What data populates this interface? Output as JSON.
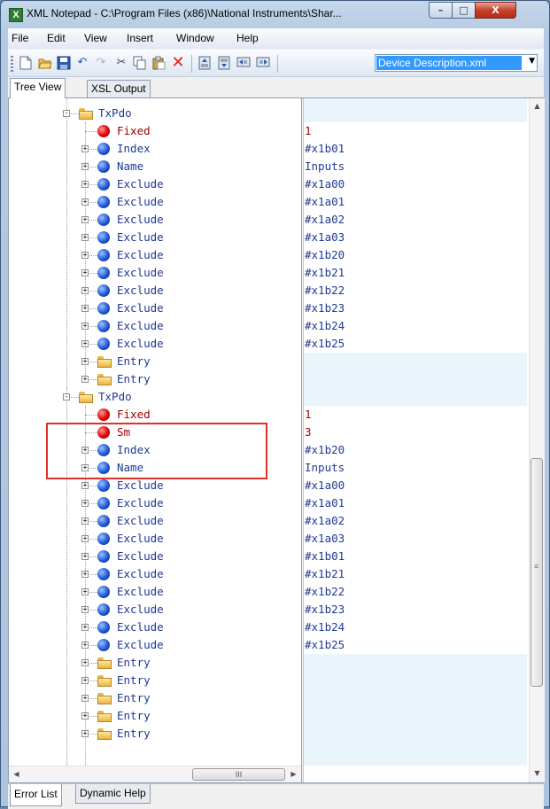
{
  "window": {
    "title": "XML Notepad - C:\\Program Files (x86)\\National Instruments\\Shar...",
    "app_icon": "X",
    "controls": {
      "minimize": "–",
      "maximize": "□",
      "close": "X"
    }
  },
  "menu": [
    "File",
    "Edit",
    "View",
    "Insert",
    "Window",
    "Help"
  ],
  "toolbar": {
    "icons": [
      "new-icon",
      "open-icon",
      "save-icon",
      "undo-icon",
      "redo-icon",
      "cut-icon",
      "copy-icon",
      "paste-icon",
      "delete-icon",
      "nudge-up-icon",
      "nudge-down-icon",
      "nudge-left-icon",
      "nudge-right-icon"
    ],
    "file_combo": "Device Description.xml"
  },
  "tabs_top": [
    "Tree View",
    "XSL Output"
  ],
  "tabs_bottom": [
    "Error List",
    "Dynamic Help"
  ],
  "tree": [
    {
      "level": 0,
      "kind": "folder",
      "expander": "-",
      "label": "TxPdo",
      "value": ""
    },
    {
      "level": 1,
      "kind": "attr",
      "expander": "",
      "label": "Fixed",
      "value": "1"
    },
    {
      "level": 1,
      "kind": "elem",
      "expander": "+",
      "label": "Index",
      "value": "#x1b01"
    },
    {
      "level": 1,
      "kind": "elem",
      "expander": "+",
      "label": "Name",
      "value": "Inputs"
    },
    {
      "level": 1,
      "kind": "elem",
      "expander": "+",
      "label": "Exclude",
      "value": "#x1a00"
    },
    {
      "level": 1,
      "kind": "elem",
      "expander": "+",
      "label": "Exclude",
      "value": "#x1a01"
    },
    {
      "level": 1,
      "kind": "elem",
      "expander": "+",
      "label": "Exclude",
      "value": "#x1a02"
    },
    {
      "level": 1,
      "kind": "elem",
      "expander": "+",
      "label": "Exclude",
      "value": "#x1a03"
    },
    {
      "level": 1,
      "kind": "elem",
      "expander": "+",
      "label": "Exclude",
      "value": "#x1b20"
    },
    {
      "level": 1,
      "kind": "elem",
      "expander": "+",
      "label": "Exclude",
      "value": "#x1b21"
    },
    {
      "level": 1,
      "kind": "elem",
      "expander": "+",
      "label": "Exclude",
      "value": "#x1b22"
    },
    {
      "level": 1,
      "kind": "elem",
      "expander": "+",
      "label": "Exclude",
      "value": "#x1b23"
    },
    {
      "level": 1,
      "kind": "elem",
      "expander": "+",
      "label": "Exclude",
      "value": "#x1b24"
    },
    {
      "level": 1,
      "kind": "elem",
      "expander": "+",
      "label": "Exclude",
      "value": "#x1b25"
    },
    {
      "level": 1,
      "kind": "folder",
      "expander": "+",
      "label": "Entry",
      "value": ""
    },
    {
      "level": 1,
      "kind": "folder",
      "expander": "+",
      "label": "Entry",
      "value": ""
    },
    {
      "level": 0,
      "kind": "folder",
      "expander": "-",
      "label": "TxPdo",
      "value": ""
    },
    {
      "level": 1,
      "kind": "attr",
      "expander": "",
      "label": "Fixed",
      "value": "1"
    },
    {
      "level": 1,
      "kind": "attr",
      "expander": "",
      "label": "Sm",
      "value": "3"
    },
    {
      "level": 1,
      "kind": "elem",
      "expander": "+",
      "label": "Index",
      "value": "#x1b20"
    },
    {
      "level": 1,
      "kind": "elem",
      "expander": "+",
      "label": "Name",
      "value": "Inputs"
    },
    {
      "level": 1,
      "kind": "elem",
      "expander": "+",
      "label": "Exclude",
      "value": "#x1a00"
    },
    {
      "level": 1,
      "kind": "elem",
      "expander": "+",
      "label": "Exclude",
      "value": "#x1a01"
    },
    {
      "level": 1,
      "kind": "elem",
      "expander": "+",
      "label": "Exclude",
      "value": "#x1a02"
    },
    {
      "level": 1,
      "kind": "elem",
      "expander": "+",
      "label": "Exclude",
      "value": "#x1a03"
    },
    {
      "level": 1,
      "kind": "elem",
      "expander": "+",
      "label": "Exclude",
      "value": "#x1b01"
    },
    {
      "level": 1,
      "kind": "elem",
      "expander": "+",
      "label": "Exclude",
      "value": "#x1b21"
    },
    {
      "level": 1,
      "kind": "elem",
      "expander": "+",
      "label": "Exclude",
      "value": "#x1b22"
    },
    {
      "level": 1,
      "kind": "elem",
      "expander": "+",
      "label": "Exclude",
      "value": "#x1b23"
    },
    {
      "level": 1,
      "kind": "elem",
      "expander": "+",
      "label": "Exclude",
      "value": "#x1b24"
    },
    {
      "level": 1,
      "kind": "elem",
      "expander": "+",
      "label": "Exclude",
      "value": "#x1b25"
    },
    {
      "level": 1,
      "kind": "folder",
      "expander": "+",
      "label": "Entry",
      "value": ""
    },
    {
      "level": 1,
      "kind": "folder",
      "expander": "+",
      "label": "Entry",
      "value": ""
    },
    {
      "level": 1,
      "kind": "folder",
      "expander": "+",
      "label": "Entry",
      "value": ""
    },
    {
      "level": 1,
      "kind": "folder",
      "expander": "+",
      "label": "Entry",
      "value": ""
    },
    {
      "level": 1,
      "kind": "folder",
      "expander": "+",
      "label": "Entry",
      "value": ""
    }
  ],
  "scrollbars": {
    "vertical_grip": "≡",
    "horizontal_grip": "III"
  },
  "colors": {
    "attribute": "#a00000",
    "element": "#1f3a93",
    "highlight_box": "#e0302a",
    "selection": "#3399ff"
  }
}
